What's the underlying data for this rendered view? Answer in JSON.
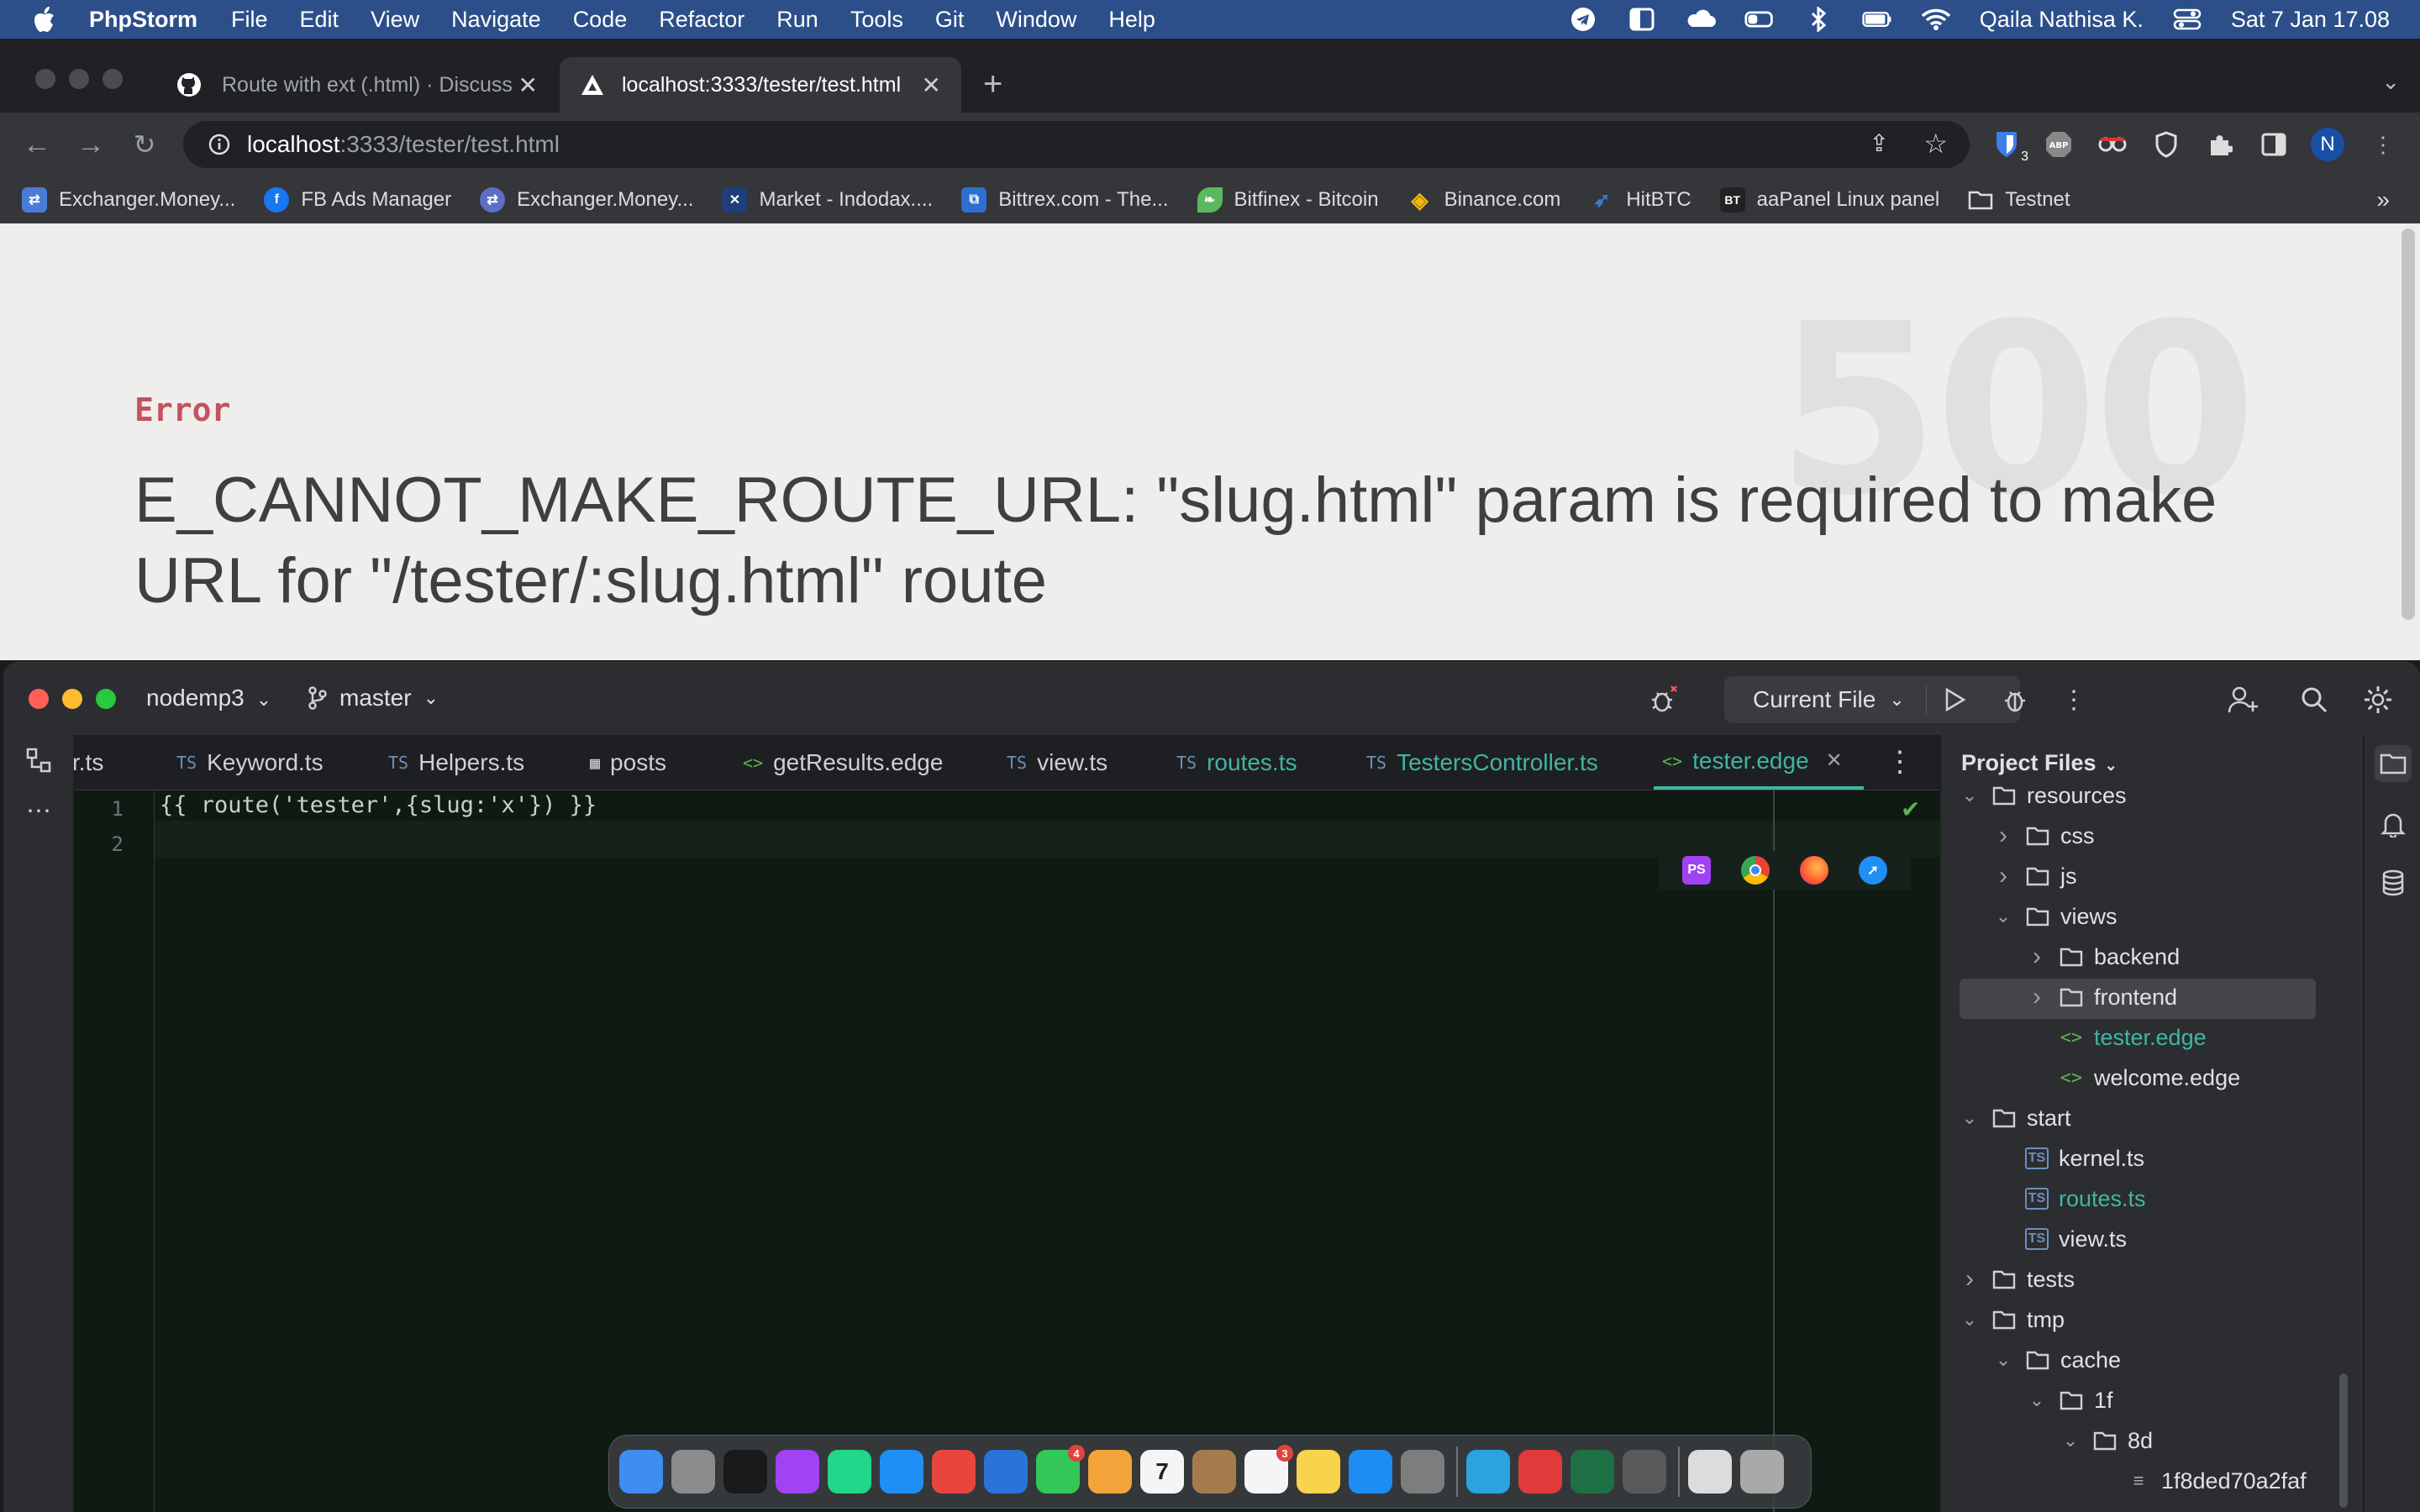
{
  "menubar": {
    "app_name": "PhpStorm",
    "items": [
      "File",
      "Edit",
      "View",
      "Navigate",
      "Code",
      "Refactor",
      "Run",
      "Tools",
      "Git",
      "Window",
      "Help"
    ],
    "user": "Qaila Nathisa K.",
    "datetime": "Sat 7 Jan  17.08",
    "status_icons": [
      "telegram-icon",
      "sidebar-icon",
      "cloud-icon",
      "battery-toggle-icon",
      "bluetooth-icon",
      "battery-icon",
      "wifi-icon",
      "control-center-icon"
    ]
  },
  "browser": {
    "tabs": [
      {
        "title": "Route with ext (.html) · Discuss",
        "icon": "github-icon"
      },
      {
        "title": "localhost:3333/tester/test.html",
        "icon": "adonis-icon"
      }
    ],
    "url_host": "localhost",
    "url_path": ":3333/tester/test.html",
    "extension_badge": "3",
    "profile_initial": "N",
    "bookmarks": [
      {
        "label": "Exchanger.Money...",
        "color": "#4a7bd6"
      },
      {
        "label": "FB Ads Manager",
        "color": "#1877f2"
      },
      {
        "label": "Exchanger.Money...",
        "color": "#5d6fc4"
      },
      {
        "label": "Market - Indodax....",
        "color": "#1f3e7a"
      },
      {
        "label": "Bittrex.com - The...",
        "color": "#2f6fd1"
      },
      {
        "label": "Bitfinex - Bitcoin",
        "color": "#5bb85d"
      },
      {
        "label": "Binance.com",
        "color": "#f0b90b"
      },
      {
        "label": "HitBTC",
        "color": "#3c7dd9"
      },
      {
        "label": "aaPanel Linux panel",
        "color": "#222222",
        "glyph": "BT"
      },
      {
        "label": "Testnet",
        "color": "#888888"
      }
    ],
    "bookmarks_more": "»"
  },
  "error_page": {
    "status_code": "500",
    "label": "Error",
    "message": "E_CANNOT_MAKE_ROUTE_URL: \"slug.html\" param is required to make URL for \"/tester/:slug.html\" route"
  },
  "ide": {
    "project": "nodemp3",
    "branch": "master",
    "run_config": "Current File",
    "editor_tabs": [
      {
        "label": "r.ts",
        "icon": "ts"
      },
      {
        "label": "Keyword.ts",
        "icon": "ts"
      },
      {
        "label": "Helpers.ts",
        "icon": "ts"
      },
      {
        "label": "posts",
        "icon": "table"
      },
      {
        "label": "getResults.edge",
        "icon": "edge"
      },
      {
        "label": "view.ts",
        "icon": "ts"
      },
      {
        "label": "routes.ts",
        "icon": "ts"
      },
      {
        "label": "TestersController.ts",
        "icon": "ts"
      },
      {
        "label": "tester.edge",
        "icon": "edge"
      }
    ],
    "code_lines": [
      "{{ route('tester',{slug:'x'}) }}",
      ""
    ],
    "line_numbers": [
      "1",
      "2"
    ],
    "project_panel_title": "Project Files",
    "tree": [
      {
        "label": "resources",
        "type": "folder",
        "open": true
      },
      {
        "label": "css",
        "type": "folder",
        "open": false
      },
      {
        "label": "js",
        "type": "folder",
        "open": false
      },
      {
        "label": "views",
        "type": "folder",
        "open": true
      },
      {
        "label": "backend",
        "type": "folder",
        "open": false
      },
      {
        "label": "frontend",
        "type": "folder",
        "open": false
      },
      {
        "label": "tester.edge",
        "type": "edge"
      },
      {
        "label": "welcome.edge",
        "type": "edge"
      },
      {
        "label": "start",
        "type": "folder",
        "open": true
      },
      {
        "label": "kernel.ts",
        "type": "ts"
      },
      {
        "label": "routes.ts",
        "type": "ts"
      },
      {
        "label": "view.ts",
        "type": "ts"
      },
      {
        "label": "tests",
        "type": "folder",
        "open": false
      },
      {
        "label": "tmp",
        "type": "folder",
        "open": true
      },
      {
        "label": "cache",
        "type": "folder",
        "open": true
      },
      {
        "label": "1f",
        "type": "folder",
        "open": true
      },
      {
        "label": "8d",
        "type": "folder",
        "open": true
      },
      {
        "label": "1f8ded70a2faf",
        "type": "file"
      }
    ]
  },
  "dock": {
    "apps": [
      {
        "name": "finder-icon",
        "color": "#3d8ef0"
      },
      {
        "name": "launchpad-icon",
        "color": "#8c8c8c"
      },
      {
        "name": "terminal-icon",
        "color": "#1a1a1a"
      },
      {
        "name": "phpstorm-icon",
        "color": "#a142f4"
      },
      {
        "name": "pycharm-icon",
        "color": "#21d789"
      },
      {
        "name": "safari-icon",
        "color": "#1f8ff5"
      },
      {
        "name": "chrome-icon",
        "color": "#e8453c"
      },
      {
        "name": "navigation-icon",
        "color": "#2a74d9"
      },
      {
        "name": "messages-icon",
        "color": "#34c759",
        "badge": "4"
      },
      {
        "name": "photos-icon",
        "color": "#f2a33a"
      },
      {
        "name": "calendar-icon",
        "color": "#f5f5f5",
        "glyph": "7"
      },
      {
        "name": "archive-icon",
        "color": "#a57b4e"
      },
      {
        "name": "reminders-icon",
        "color": "#f5f5f5",
        "badge": "3"
      },
      {
        "name": "notes-icon",
        "color": "#f7d44c"
      },
      {
        "name": "appstore-icon",
        "color": "#1e8cf5"
      },
      {
        "name": "system-settings-icon",
        "color": "#7d7d7d"
      },
      {
        "name": "telegram-icon",
        "color": "#2aa3df"
      },
      {
        "name": "creative-cloud-icon",
        "color": "#e03a3a"
      },
      {
        "name": "excel-icon",
        "color": "#1e7145"
      },
      {
        "name": "calculator-icon",
        "color": "#5a5a5a"
      },
      {
        "name": "documents-icon",
        "color": "#dcdcdc"
      },
      {
        "name": "trash-icon",
        "color": "#a9a9a9"
      }
    ]
  }
}
